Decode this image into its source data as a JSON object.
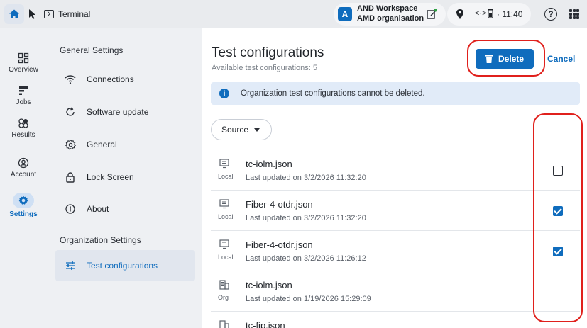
{
  "topbar": {
    "app_label": "Terminal",
    "workspace_avatar": "A",
    "workspace_name": "AND Workspace",
    "workspace_org": "AMD organisation",
    "link_glyph": "<·>",
    "time": "· 11:40"
  },
  "rail": {
    "items": [
      {
        "label": "Overview",
        "icon": "overview-icon"
      },
      {
        "label": "Jobs",
        "icon": "jobs-icon"
      },
      {
        "label": "Results",
        "icon": "results-icon"
      },
      {
        "label": "Account",
        "icon": "account-icon"
      },
      {
        "label": "Settings",
        "icon": "gear-icon",
        "active": true
      }
    ]
  },
  "settings": {
    "general_title": "General Settings",
    "items": [
      {
        "label": "Connections",
        "icon": "wifi-icon"
      },
      {
        "label": "Software update",
        "icon": "refresh-icon"
      },
      {
        "label": "General",
        "icon": "gear-icon"
      },
      {
        "label": "Lock Screen",
        "icon": "lock-icon"
      },
      {
        "label": "About",
        "icon": "info-icon"
      }
    ],
    "org_title": "Organization Settings",
    "org_items": [
      {
        "label": "Test configurations",
        "icon": "sliders-icon",
        "selected": true
      }
    ]
  },
  "main": {
    "title": "Test configurations",
    "subtitle": "Available test configurations: 5",
    "delete_label": "Delete",
    "cancel_label": "Cancel",
    "info_text": "Organization test configurations cannot be deleted.",
    "source_filter": "Source",
    "rows": [
      {
        "name": "tc-iolm.json",
        "updated": "Last updated on 3/2/2026 11:32:20",
        "type": "Local",
        "checked": false
      },
      {
        "name": "Fiber-4-otdr.json",
        "updated": "Last updated on 3/2/2026 11:32:20",
        "type": "Local",
        "checked": true
      },
      {
        "name": "Fiber-4-otdr.json",
        "updated": "Last updated on 3/2/2026 11:26:12",
        "type": "Local",
        "checked": true
      },
      {
        "name": "tc-iolm.json",
        "updated": "Last updated on 1/19/2026 15:29:09",
        "type": "Org",
        "checked": null
      },
      {
        "name": "tc-fip.json",
        "updated": "",
        "type": "",
        "checked": null
      }
    ]
  },
  "colors": {
    "accent": "#0f6cbd",
    "annotation": "#e0201c",
    "info_bg": "#e1ebf8"
  }
}
